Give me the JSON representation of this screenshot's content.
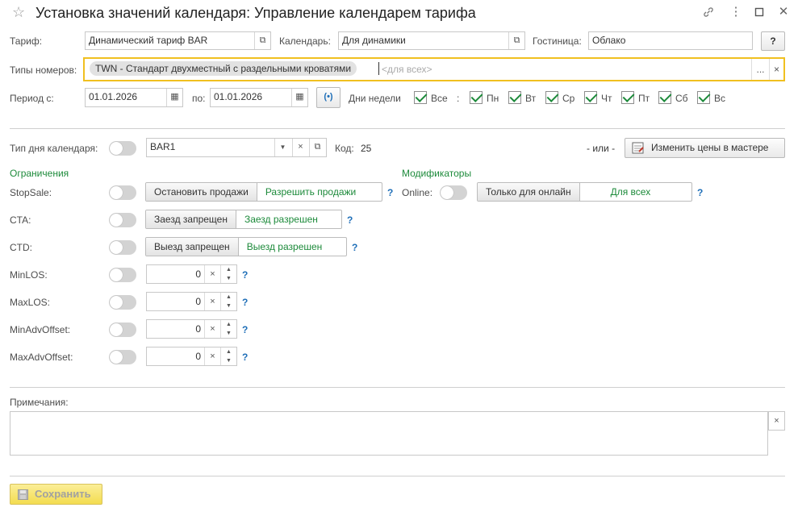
{
  "window": {
    "title": "Установка значений календаря: Управление календарем тарифа"
  },
  "tariff": {
    "label": "Тариф:",
    "value": "Динамический тариф BAR"
  },
  "calendar": {
    "label": "Календарь:",
    "value": "Для динамики"
  },
  "hotel": {
    "label": "Гостиница:",
    "value": "Облако"
  },
  "help_button": "?",
  "room_types": {
    "label": "Типы номеров:",
    "selected": "TWN - Стандарт двухместный с раздельными кроватями",
    "placeholder": "<для всех>",
    "more": "...",
    "clear": "×"
  },
  "period": {
    "label": "Период с:",
    "from": "01.01.2026",
    "to_label": "по:",
    "to": "01.01.2026"
  },
  "weekdays": {
    "label": "Дни недели",
    "all": "Все",
    "separator": ":",
    "days": [
      "Пн",
      "Вт",
      "Ср",
      "Чт",
      "Пт",
      "Сб",
      "Вс"
    ]
  },
  "day_type": {
    "label": "Тип дня календаря:",
    "value": "BAR1",
    "code_label": "Код:",
    "code_value": "25",
    "or_label": "- или -",
    "wizard_button": "Изменить цены в мастере"
  },
  "restrictions": {
    "header": "Ограничения",
    "stopsale": {
      "label": "StopSale:",
      "on": "Остановить продажи",
      "off": "Разрешить продажи"
    },
    "cta": {
      "label": "CTA:",
      "on": "Заезд запрещен",
      "off": "Заезд разрешен"
    },
    "ctd": {
      "label": "CTD:",
      "on": "Выезд запрещен",
      "off": "Выезд разрешен"
    },
    "minlos": {
      "label": "MinLOS:",
      "value": "0"
    },
    "maxlos": {
      "label": "MaxLOS:",
      "value": "0"
    },
    "minadv": {
      "label": "MinAdvOffset:",
      "value": "0"
    },
    "maxadv": {
      "label": "MaxAdvOffset:",
      "value": "0"
    }
  },
  "modifiers": {
    "header": "Модификаторы",
    "online_label": "Online:",
    "online_only": "Только для онлайн",
    "for_all": "Для всех"
  },
  "notes": {
    "label": "Примечания:"
  },
  "save_button": "Сохранить",
  "help_mark": "?",
  "clear_mark": "×",
  "spin_up": "▲",
  "spin_down": "▼",
  "colors": {
    "accent_green": "#1c8a3a",
    "help_blue": "#1f6fb8",
    "focus_border": "#f0c020",
    "save_yellow": "#f7e36b"
  }
}
